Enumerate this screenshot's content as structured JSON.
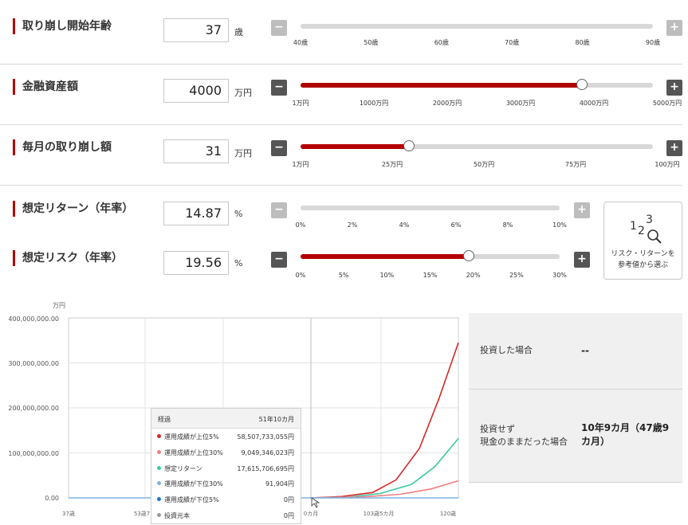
{
  "colors": {
    "accent": "#b30000",
    "button_on": "#555555",
    "button_off": "#bdbdbd",
    "track": "#d8d8d8"
  },
  "rows": {
    "start_age": {
      "label": "取り崩し開始年齢",
      "value": "37",
      "unit": "歳",
      "minus": "−",
      "plus": "+",
      "slider_fraction": 0,
      "ticks": [
        "40歳",
        "50歳",
        "60歳",
        "70歳",
        "80歳",
        "90歳"
      ]
    },
    "assets": {
      "label": "金融資産額",
      "value": "4000",
      "unit": "万円",
      "minus": "−",
      "plus": "+",
      "slider_fraction": 0.8,
      "ticks": [
        "1万円",
        "1000万円",
        "2000万円",
        "3000万円",
        "4000万円",
        "5000万円"
      ]
    },
    "withdrawal": {
      "label": "毎月の取り崩し額",
      "value": "31",
      "unit": "万円",
      "minus": "−",
      "plus": "+",
      "slider_fraction": 0.31,
      "ticks": [
        "1万円",
        "25万円",
        "50万円",
        "75万円",
        "100万円"
      ]
    },
    "return": {
      "label": "想定リターン（年率）",
      "value": "14.87",
      "unit": "%",
      "minus": "−",
      "plus": "+",
      "slider_fraction": 1,
      "ticks": [
        "0%",
        "2%",
        "4%",
        "6%",
        "8%",
        "10%"
      ]
    },
    "risk": {
      "label": "想定リスク（年率）",
      "value": "19.56",
      "unit": "%",
      "minus": "−",
      "plus": "+",
      "slider_fraction": 0.652,
      "ticks": [
        "0%",
        "5%",
        "10%",
        "15%",
        "20%",
        "25%",
        "30%"
      ]
    }
  },
  "reference_button": {
    "digits": "123",
    "text_line1": "リスク・リターンを",
    "text_line2": "参考値から選ぶ",
    "icon": "magnifier-icon"
  },
  "chart_data": {
    "type": "line",
    "ylabel": "万円",
    "y_ticks": [
      "400,000,000.00",
      "300,000,000.00",
      "200,000,000.00",
      "100,000,000.00",
      "0.00"
    ],
    "ylim": [
      0,
      400000000
    ],
    "x_ticks": [
      "37歳",
      "53歳7",
      "0カ月",
      "103歳5カ月",
      "120歳"
    ],
    "grid": true,
    "series": [
      {
        "name": "運用成績が上位5%",
        "color": "#d62728",
        "x": [
          0.62,
          0.7,
          0.78,
          0.84,
          0.9,
          0.95,
          1.0
        ],
        "values": [
          0,
          3000000,
          12000000,
          40000000,
          110000000,
          220000000,
          345000000
        ]
      },
      {
        "name": "想定リターン",
        "color": "#3cc9a4",
        "x": [
          0.62,
          0.72,
          0.8,
          0.88,
          0.94,
          1.0
        ],
        "values": [
          0,
          2000000,
          10000000,
          30000000,
          70000000,
          132000000
        ]
      },
      {
        "name": "運用成績が上位30%",
        "color": "#f08080",
        "x": [
          0.62,
          0.75,
          0.85,
          0.93,
          1.0
        ],
        "values": [
          0,
          2000000,
          8000000,
          20000000,
          38000000
        ]
      },
      {
        "name": "運用成績が下位30%",
        "color": "#7fb2e5",
        "x": [
          0.0,
          1.0
        ],
        "values": [
          0,
          0
        ]
      }
    ]
  },
  "tooltip": {
    "title": "経過",
    "elapsed": "51年10カ月",
    "items": [
      {
        "name": "運用成績が上位5%",
        "value": "58,507,733,055円",
        "color": "#d62728"
      },
      {
        "name": "運用成績が上位30%",
        "value": "9,049,346,023円",
        "color": "#f08080"
      },
      {
        "name": "想定リターン",
        "value": "17,615,706,695円",
        "color": "#3cc9a4"
      },
      {
        "name": "運用成績が下位30%",
        "value": "91,904円",
        "color": "#7fb2e5"
      },
      {
        "name": "運用成績が下位5%",
        "value": "0円",
        "color": "#1f77d0"
      },
      {
        "name": "投資元本",
        "value": "0円",
        "color": "#999999"
      }
    ]
  },
  "result_panel": {
    "invested_label": "投資した場合",
    "invested_value": "--",
    "not_invested_label1": "投資せず",
    "not_invested_label2": "現金のままだった場合",
    "not_invested_value": "10年9カ月（47歳9カ月）"
  }
}
